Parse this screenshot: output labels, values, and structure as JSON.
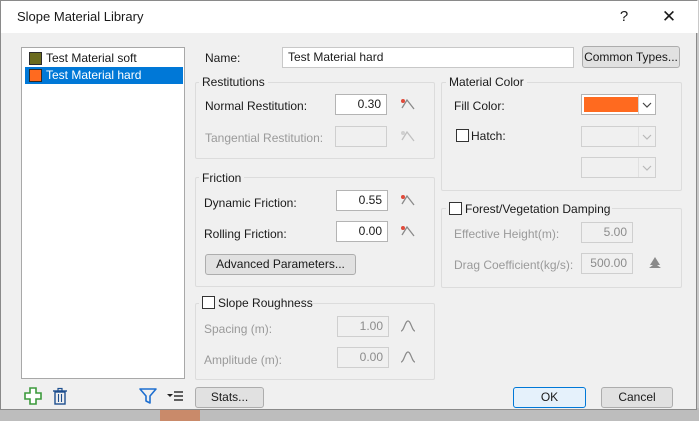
{
  "dialog": {
    "title": "Slope Material Library",
    "help": "?",
    "close": "✕"
  },
  "materials": [
    {
      "name": "Test Material soft",
      "color": "#6b6b1e",
      "selected": false
    },
    {
      "name": "Test Material hard",
      "color": "#ff6a1f",
      "selected": true
    }
  ],
  "name_row": {
    "label": "Name:",
    "value": "Test Material hard",
    "common_types": "Common Types..."
  },
  "restitutions": {
    "title": "Restitutions",
    "normal_label": "Normal Restitution:",
    "normal_value": "0.30",
    "tangential_label": "Tangential Restitution:",
    "tangential_value": ""
  },
  "friction": {
    "title": "Friction",
    "dynamic_label": "Dynamic Friction:",
    "dynamic_value": "0.55",
    "rolling_label": "Rolling Friction:",
    "rolling_value": "0.00",
    "advanced": "Advanced Parameters..."
  },
  "slope_roughness": {
    "title": "Slope Roughness",
    "checked": false,
    "spacing_label": "Spacing (m):",
    "spacing_value": "1.00",
    "amplitude_label": "Amplitude (m):",
    "amplitude_value": "0.00"
  },
  "material_color": {
    "title": "Material Color",
    "fill_label": "Fill Color:",
    "fill_color": "#ff6a1f",
    "hatch_label": "Hatch:",
    "hatch_checked": false
  },
  "forest": {
    "title": "Forest/Vegetation Damping",
    "checked": false,
    "height_label": "Effective Height(m):",
    "height_value": "5.00",
    "drag_label": "Drag Coefficient(kg/s):",
    "drag_value": "500.00"
  },
  "footer": {
    "stats": "Stats...",
    "ok": "OK",
    "cancel": "Cancel"
  },
  "icons": {
    "add": "plus-icon",
    "delete": "trash-icon",
    "filter": "filter-icon",
    "sort": "sort-menu-icon",
    "tree": "tree-icon",
    "statistics": "statistics-icon",
    "waveform": "waveform-icon"
  },
  "colors": {
    "accent": "#0078d7",
    "add_green": "#3c9a3c",
    "filter_blue": "#1e6fd0"
  }
}
